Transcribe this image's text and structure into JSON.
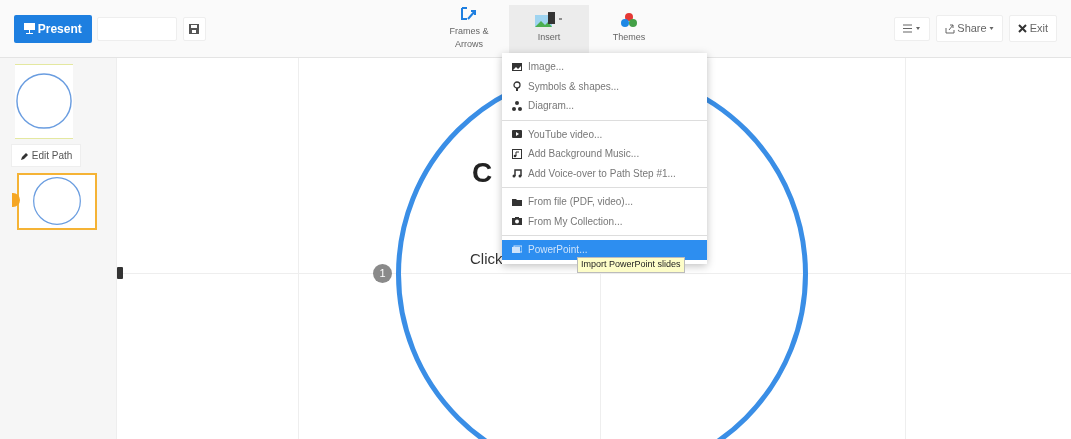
{
  "toolbar": {
    "present": "Present",
    "tools": [
      {
        "label": "Frames & Arrows",
        "kind": "frames",
        "selected": false
      },
      {
        "label": "Insert",
        "kind": "insert",
        "selected": true
      },
      {
        "label": "Themes",
        "kind": "themes",
        "selected": false
      }
    ],
    "share": "Share",
    "exit": "Exit"
  },
  "sidebar": {
    "edit_path": "Edit Path",
    "thumbnails": [
      {
        "selected": false
      },
      {
        "selected": true
      }
    ]
  },
  "canvas": {
    "title_fragment": "C",
    "body_fragment": "Click",
    "step_number": "1"
  },
  "insert_menu": {
    "items": [
      {
        "kind": "item",
        "label": "Image...",
        "selected": false
      },
      {
        "kind": "item",
        "label": "Symbols & shapes...",
        "selected": false
      },
      {
        "kind": "item",
        "label": "Diagram...",
        "selected": false
      },
      {
        "kind": "divider"
      },
      {
        "kind": "item",
        "label": "YouTube video...",
        "selected": false
      },
      {
        "kind": "item",
        "label": "Add Background Music...",
        "selected": false
      },
      {
        "kind": "item",
        "label": "Add Voice-over to Path Step #1...",
        "selected": false
      },
      {
        "kind": "divider"
      },
      {
        "kind": "item",
        "label": "From file (PDF, video)...",
        "selected": false
      },
      {
        "kind": "item",
        "label": "From My Collection...",
        "selected": false
      },
      {
        "kind": "divider"
      },
      {
        "kind": "item",
        "label": "PowerPoint...",
        "selected": true
      }
    ],
    "tooltip": "Import PowerPoint slides"
  }
}
